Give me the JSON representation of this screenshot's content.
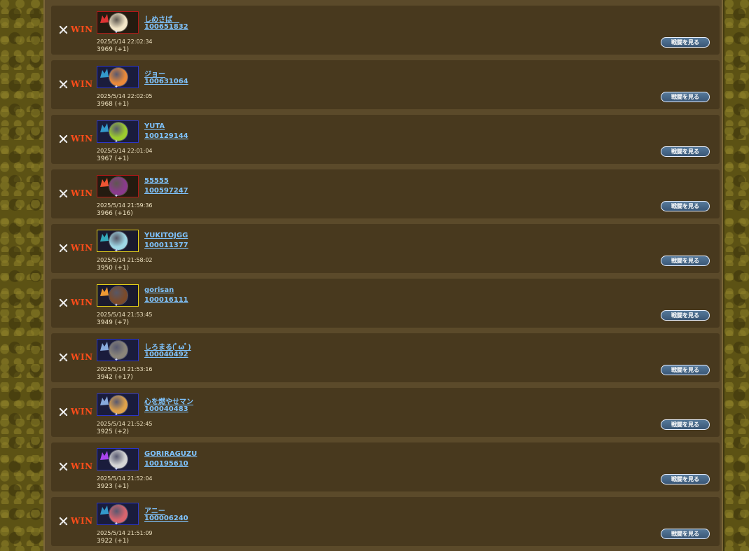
{
  "battle_button_label": "戦闘を見る",
  "result_label": "WIN",
  "colors": {
    "win": "#ff4d1a",
    "link": "#7fc4ff",
    "row_bg": "#48391e",
    "panel_bg": "#5b4a2a"
  },
  "icons": {
    "result": "crossed-swords-icon"
  },
  "rows": [
    {
      "name": "しめさば　",
      "player_id": "100651832",
      "datetime": "2025/5/14 22:02:34",
      "score": "3969 (+1)",
      "frame": "red",
      "face": "#f3e6c8",
      "chara": "#d33"
    },
    {
      "name": "ジョー",
      "player_id": "100631064",
      "datetime": "2025/5/14 22:02:05",
      "score": "3968 (+1)",
      "frame": "blue",
      "face": "#e9893a",
      "chara": "#39c"
    },
    {
      "name": "YUTA",
      "player_id": "100129144",
      "datetime": "2025/5/14 22:01:04",
      "score": "3967 (+1)",
      "frame": "blue",
      "face": "#9ccc2e",
      "chara": "#39c"
    },
    {
      "name": "55555",
      "player_id": "100597247",
      "datetime": "2025/5/14 21:59:36",
      "score": "3966 (+16)",
      "frame": "red",
      "face": "#8a3a8c",
      "chara": "#e53"
    },
    {
      "name": "YUKITOJGG",
      "player_id": "100011377",
      "datetime": "2025/5/14 21:58:02",
      "score": "3950 (+1)",
      "frame": "yellow",
      "face": "#9fd8e6",
      "chara": "#3ab"
    },
    {
      "name": "gorisan",
      "player_id": "100016111",
      "datetime": "2025/5/14 21:53:45",
      "score": "3949 (+7)",
      "frame": "yellow",
      "face": "#7a4a2a",
      "chara": "#e93"
    },
    {
      "name": "しろまる(ﾟωﾟ)",
      "player_id": "100040492",
      "datetime": "2025/5/14 21:53:16",
      "score": "3942 (+17)",
      "frame": "blue",
      "face": "#8a857a",
      "chara": "#8ad"
    },
    {
      "name": "心を燃やせマン",
      "player_id": "100040483",
      "datetime": "2025/5/14 21:52:45",
      "score": "3925 (+2)",
      "frame": "blue",
      "face": "#e0a24a",
      "chara": "#8ad"
    },
    {
      "name": "GORIRAGUZU",
      "player_id": "100195610",
      "datetime": "2025/5/14 21:52:04",
      "score": "3923 (+1)",
      "frame": "blue",
      "face": "#d6d6d6",
      "chara": "#a4e"
    },
    {
      "name": "アニー",
      "player_id": "100006240",
      "datetime": "2025/5/14 21:51:09",
      "score": "3922 (+1)",
      "frame": "blue",
      "face": "#d8646e",
      "chara": "#39c"
    }
  ]
}
